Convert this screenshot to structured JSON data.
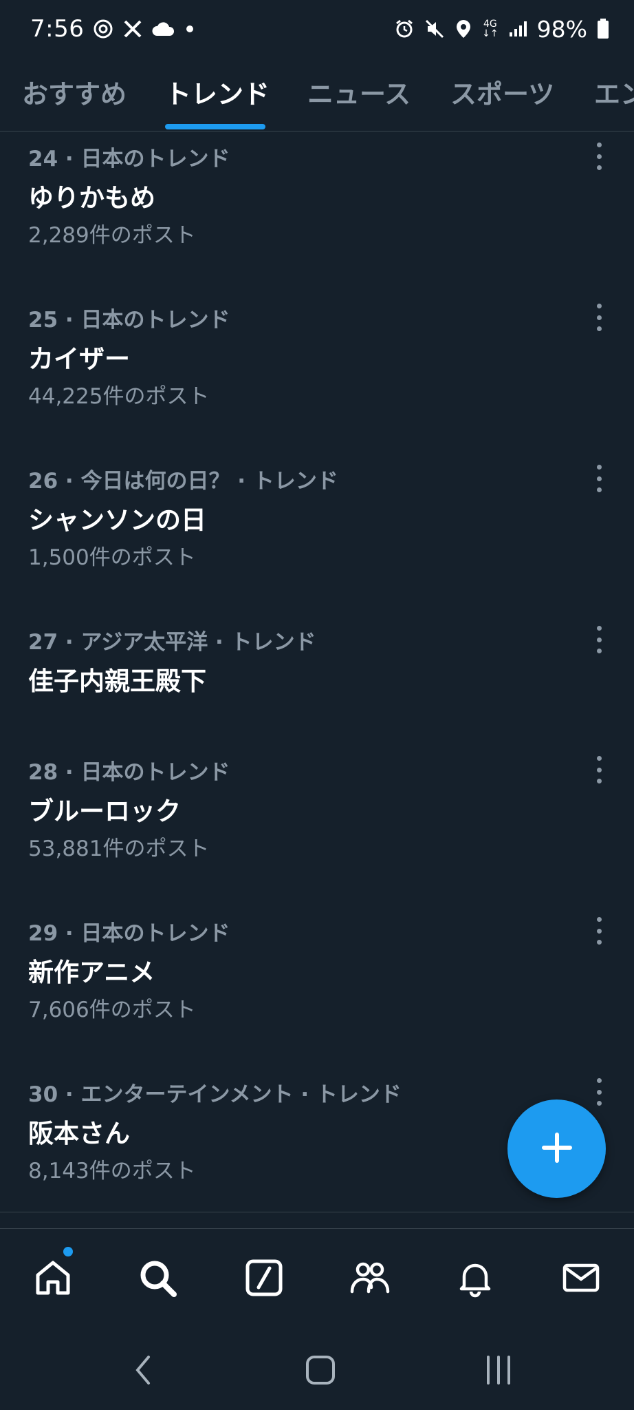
{
  "status_bar": {
    "time": "7:56",
    "network": "4G",
    "battery": "98%"
  },
  "tabs": [
    {
      "label": "おすすめ"
    },
    {
      "label": "トレンド"
    },
    {
      "label": "ニュース"
    },
    {
      "label": "スポーツ"
    },
    {
      "label": "エン"
    }
  ],
  "trends": [
    {
      "meta": "24 · 日本のトレンド",
      "name": "ゆりかもめ",
      "count": "2,289件のポスト"
    },
    {
      "meta": "25 · 日本のトレンド",
      "name": "カイザー",
      "count": "44,225件のポスト"
    },
    {
      "meta": "26 · 今日は何の日？ · トレンド",
      "name": "シャンソンの日",
      "count": "1,500件のポスト"
    },
    {
      "meta": "27 · アジア太平洋 · トレンド",
      "name": "佳子内親王殿下",
      "count": ""
    },
    {
      "meta": "28 · 日本のトレンド",
      "name": "ブルーロック",
      "count": "53,881件のポスト"
    },
    {
      "meta": "29 · 日本のトレンド",
      "name": "新作アニメ",
      "count": "7,606件のポスト"
    },
    {
      "meta": "30 · エンターテインメント · トレンド",
      "name": "阪本さん",
      "count": "8,143件のポスト"
    }
  ],
  "bottom_nav": [
    "home-icon",
    "search-icon",
    "grok-icon",
    "communities-icon",
    "notifications-icon",
    "messages-icon"
  ],
  "colors": {
    "background": "#15202b",
    "accent": "#1d9bf0",
    "secondary_text": "#8b98a5",
    "divider": "#38444d"
  }
}
